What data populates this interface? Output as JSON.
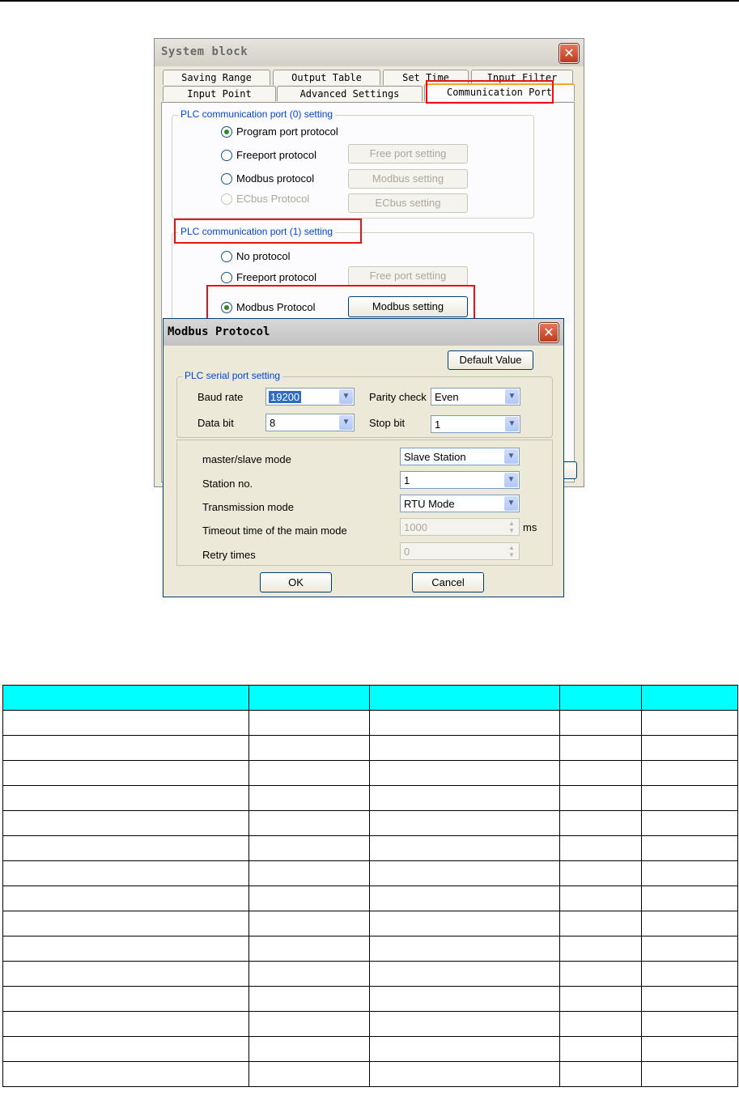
{
  "system_block": {
    "title": "System block",
    "close_glyph": "✕",
    "tabs_row1": [
      "Saving Range",
      "Output Table",
      "Set Time",
      "Input Filter"
    ],
    "tabs_row2": [
      "Input Point",
      "Advanced Settings",
      "Communication Port"
    ],
    "active_tab": "Communication Port",
    "port0": {
      "title": "PLC communication port (0) setting",
      "options": [
        {
          "label": "Program port protocol",
          "selected": true,
          "enabled": true
        },
        {
          "label": "Freeport protocol",
          "selected": false,
          "enabled": true,
          "button": "Free port setting"
        },
        {
          "label": "Modbus protocol",
          "selected": false,
          "enabled": true,
          "button": "Modbus setting"
        },
        {
          "label": "ECbus Protocol",
          "selected": false,
          "enabled": false,
          "button": "ECbus setting"
        }
      ]
    },
    "port1": {
      "title": "PLC communication port (1) setting",
      "options": [
        {
          "label": "No protocol",
          "selected": false,
          "enabled": true
        },
        {
          "label": "Freeport protocol",
          "selected": false,
          "enabled": true,
          "button": "Free port setting"
        },
        {
          "label": "Modbus Protocol",
          "selected": true,
          "enabled": true,
          "button": "Modbus setting"
        }
      ]
    }
  },
  "modbus_dialog": {
    "title": "Modbus Protocol",
    "default_button": "Default Value",
    "serial_group_title": "PLC serial port setting",
    "baud_rate": {
      "label": "Baud rate",
      "value": "19200"
    },
    "parity": {
      "label": "Parity check",
      "value": "Even"
    },
    "data_bit": {
      "label": "Data bit",
      "value": "8"
    },
    "stop_bit": {
      "label": "Stop bit",
      "value": "1"
    },
    "mode": {
      "label": "master/slave mode",
      "value": "Slave Station"
    },
    "station": {
      "label": "Station no.",
      "value": "1"
    },
    "transmission": {
      "label": "Transmission mode",
      "value": "RTU Mode"
    },
    "timeout": {
      "label": "Timeout time of the main mode",
      "value": "1000",
      "unit": "ms"
    },
    "retry": {
      "label": "Retry times",
      "value": "0"
    },
    "ok": "OK",
    "cancel": "Cancel"
  },
  "colors": {
    "highlight_red": "#ee1111",
    "group_title_blue": "#0046d5",
    "table_header_cyan": "#00ffff"
  },
  "table": {
    "columns": 5,
    "body_rows": 15
  }
}
